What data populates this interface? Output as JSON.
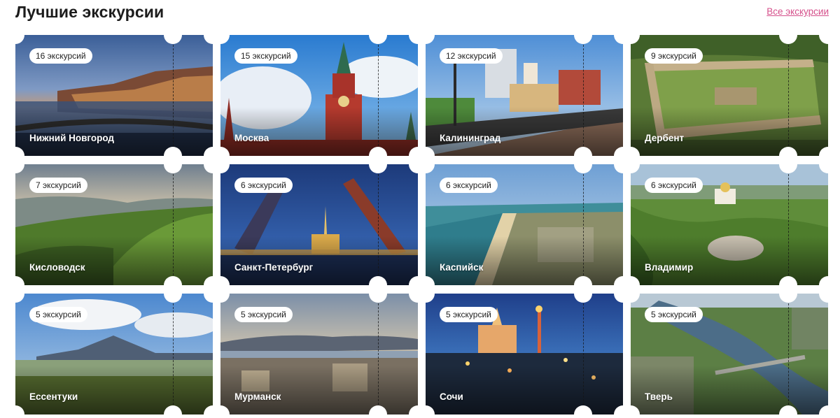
{
  "header": {
    "title": "Лучшие экскурсии",
    "all_link": "Все экскурсии"
  },
  "cards": [
    {
      "count": "16 экскурсий",
      "city": "Нижний Новгород"
    },
    {
      "count": "15 экскурсий",
      "city": "Москва"
    },
    {
      "count": "12 экскурсий",
      "city": "Калининград"
    },
    {
      "count": "9 экскурсий",
      "city": "Дербент"
    },
    {
      "count": "7 экскурсий",
      "city": "Кисловодск"
    },
    {
      "count": "6 экскурсий",
      "city": "Санкт-Петербург"
    },
    {
      "count": "6 экскурсий",
      "city": "Каспийск"
    },
    {
      "count": "6 экскурсий",
      "city": "Владимир"
    },
    {
      "count": "5 экскурсий",
      "city": "Ессентуки"
    },
    {
      "count": "5 экскурсий",
      "city": "Мурманск"
    },
    {
      "count": "5 экскурсий",
      "city": "Сочи"
    },
    {
      "count": "5 экскурсий",
      "city": "Тверь"
    }
  ]
}
